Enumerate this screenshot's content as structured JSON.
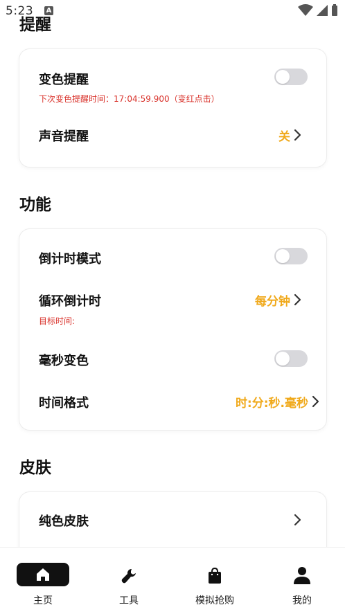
{
  "status_bar": {
    "time": "5:23",
    "a_badge": "A"
  },
  "reminder_section": {
    "title": "提醒",
    "color_reminder": {
      "label": "变色提醒",
      "on": false,
      "note": "下次变色提醒时间：17:04:59.900（变红点击）"
    },
    "sound_reminder": {
      "label": "声音提醒",
      "value": "关"
    }
  },
  "function_section": {
    "title": "功能",
    "countdown_mode": {
      "label": "倒计时模式",
      "on": false
    },
    "loop_countdown": {
      "label": "循环倒计时",
      "value": "每分钟",
      "note": "目标时间:"
    },
    "ms_color": {
      "label": "毫秒变色",
      "on": false
    },
    "time_format": {
      "label": "时间格式",
      "value": "时:分:秒.毫秒"
    }
  },
  "skin_section": {
    "title": "皮肤",
    "solid_skin": {
      "label": "纯色皮肤"
    }
  },
  "bottom_nav": {
    "items": [
      {
        "label": "主页",
        "icon": "home-icon",
        "active": true
      },
      {
        "label": "工具",
        "icon": "wrench-icon",
        "active": false
      },
      {
        "label": "模拟抢购",
        "icon": "shopping-bag-icon",
        "active": false
      },
      {
        "label": "我的",
        "icon": "user-icon",
        "active": false
      }
    ]
  },
  "colors": {
    "accent_orange": "#f0a91b",
    "note_red": "#d9322b",
    "toggle_off": "#d8d8dc"
  }
}
